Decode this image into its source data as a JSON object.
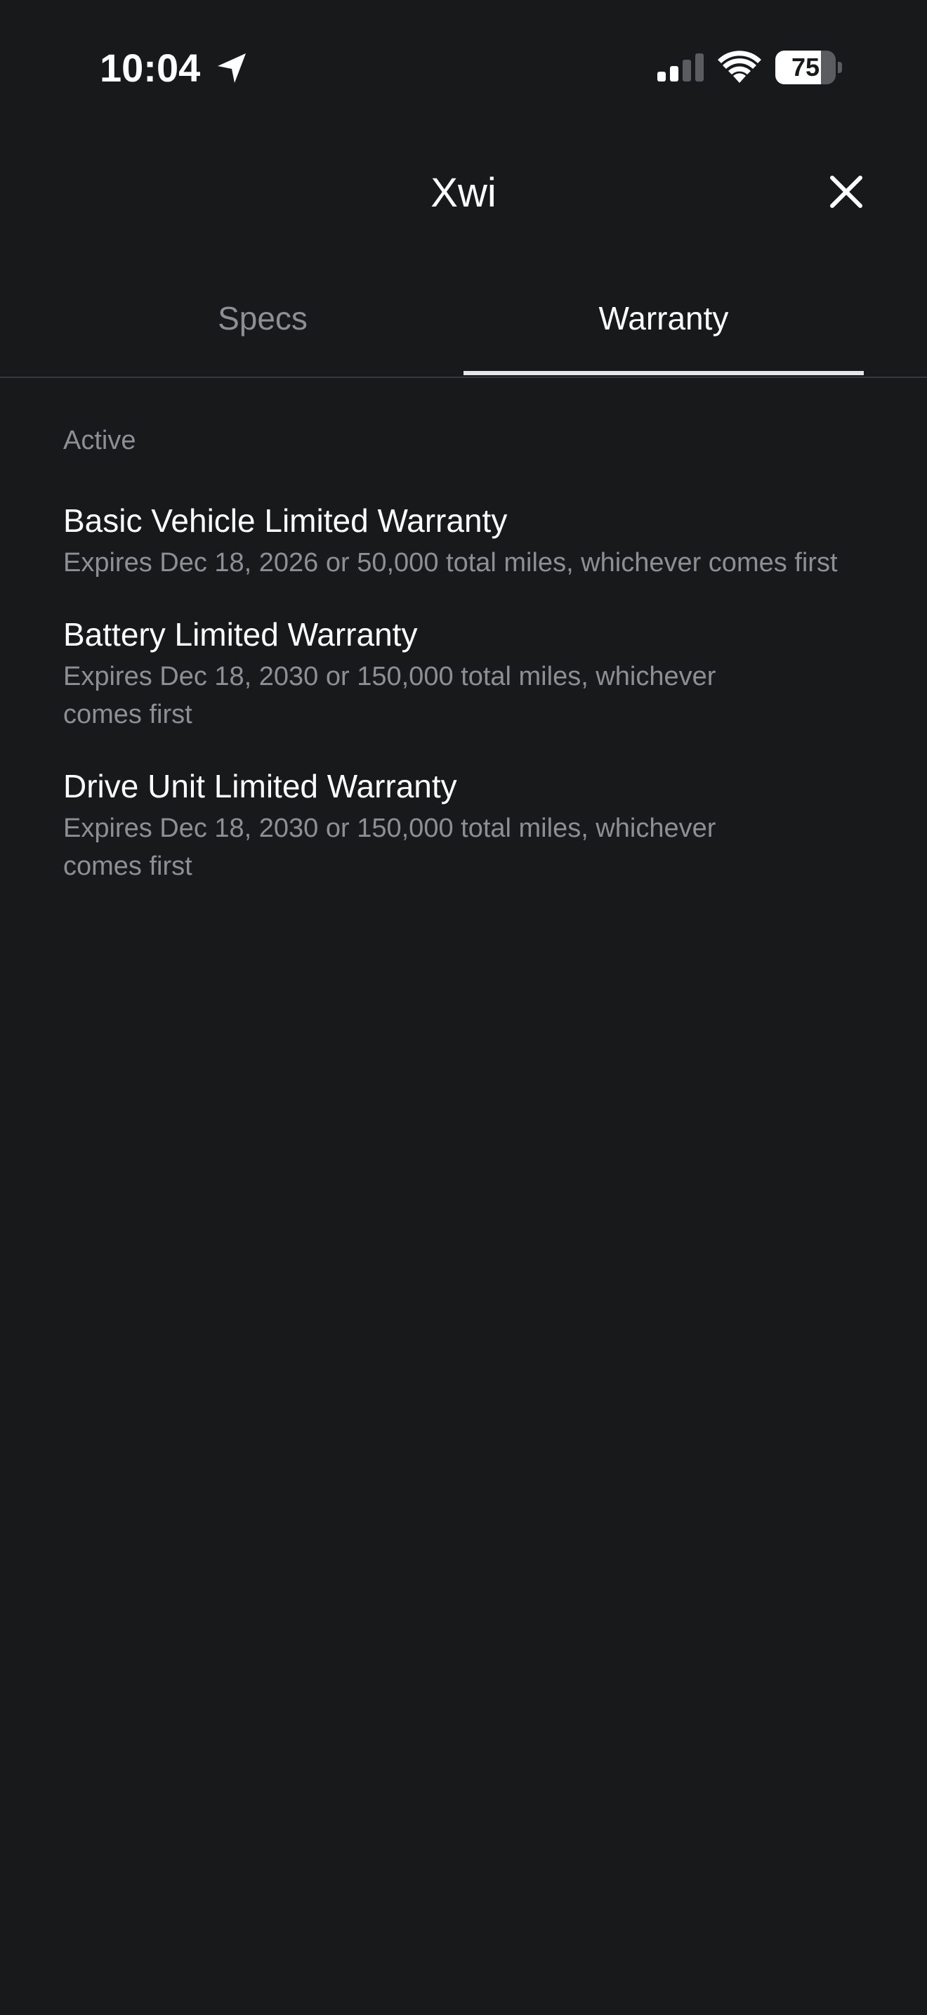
{
  "status_bar": {
    "time": "10:04",
    "battery_level": "75",
    "battery_fraction": 0.75
  },
  "header": {
    "title": "Xwi",
    "close_icon": "close-icon"
  },
  "tabs": [
    {
      "label": "Specs",
      "selected": false
    },
    {
      "label": "Warranty",
      "selected": true
    }
  ],
  "section": {
    "label": "Active"
  },
  "warranties": [
    {
      "title": "Basic Vehicle Limited Warranty",
      "detail": "Expires Dec 18, 2026 or 50,000 total miles, whichever comes first"
    },
    {
      "title": "Battery Limited Warranty",
      "detail": "Expires Dec 18, 2030 or 150,000 total miles, whichever comes first"
    },
    {
      "title": "Drive Unit Limited Warranty",
      "detail": "Expires Dec 18, 2030 or 150,000 total miles, whichever comes first"
    }
  ],
  "colors": {
    "background": "#18191b",
    "primary_text": "#ffffff",
    "secondary_text": "#8e8f93",
    "tab_indicator": "#e6e6e8",
    "divider": "#38393d"
  }
}
